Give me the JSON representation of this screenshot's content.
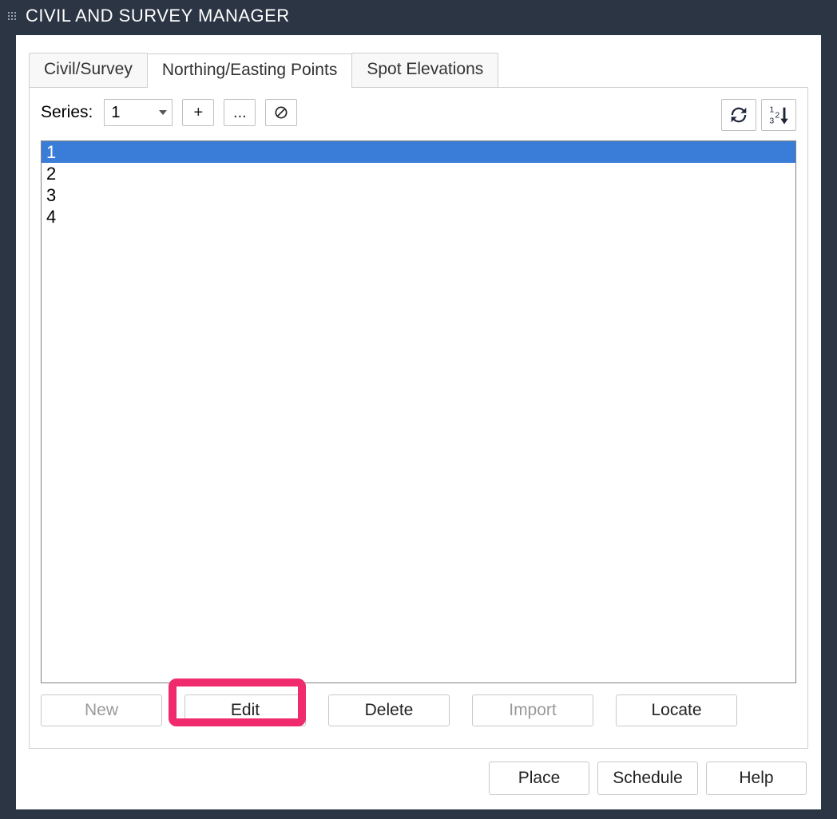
{
  "window": {
    "title": "CIVIL AND SURVEY MANAGER"
  },
  "tabs": {
    "civil": "Civil/Survey",
    "northingEasting": "Northing/Easting Points",
    "spotElev": "Spot Elevations",
    "activeIndex": 1
  },
  "series": {
    "label": "Series:",
    "value": "1",
    "add": "+",
    "more": "...",
    "clearIcon": "prohibit"
  },
  "toolbar": {
    "refreshIcon": "refresh",
    "sortIcon": "sort-123"
  },
  "list": {
    "items": [
      "1",
      "2",
      "3",
      "4"
    ],
    "selectedIndex": 0
  },
  "actions": {
    "new": "New",
    "edit": "Edit",
    "delete": "Delete",
    "import": "Import",
    "locate": "Locate"
  },
  "bottom": {
    "place": "Place",
    "schedule": "Schedule",
    "help": "Help"
  },
  "highlightAction": "edit"
}
